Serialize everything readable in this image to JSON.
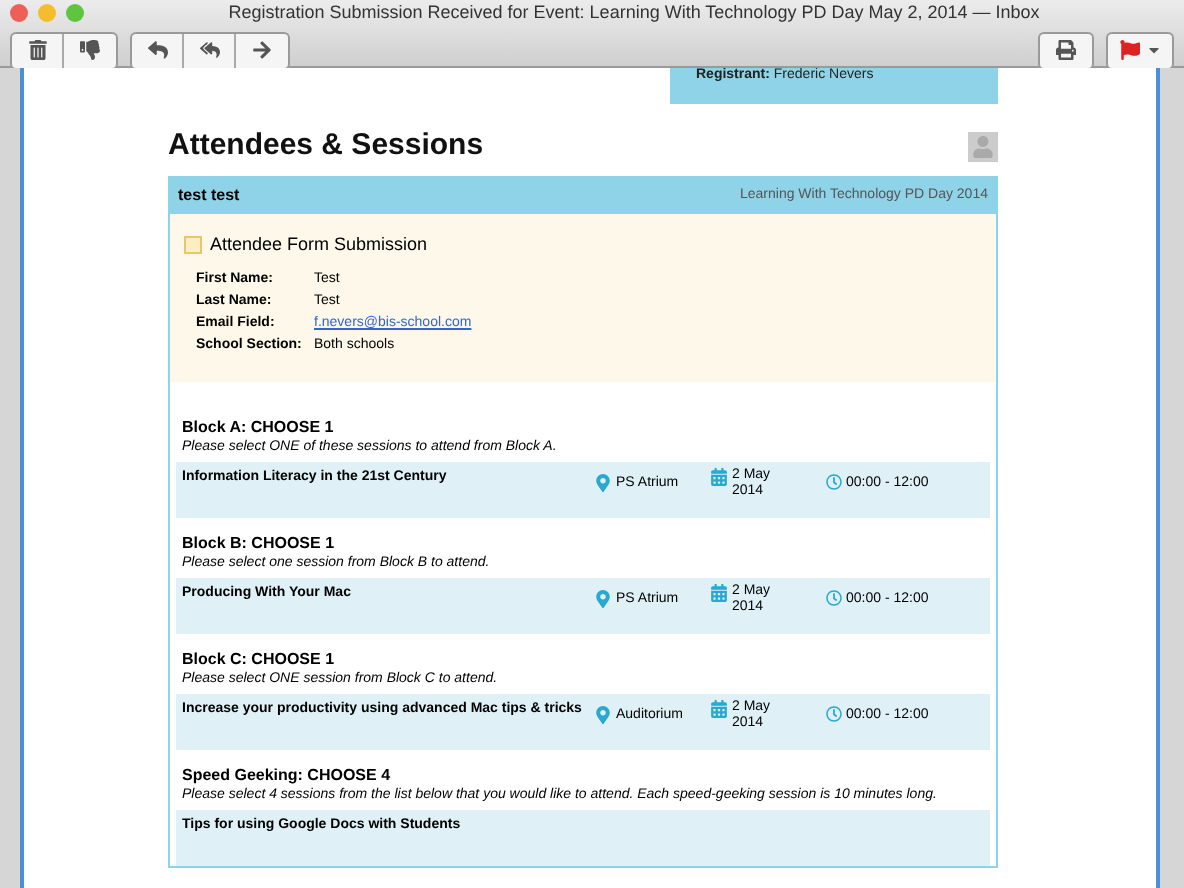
{
  "window": {
    "title": "Registration Submission Received for Event: Learning With Technology PD Day May 2, 2014 — Inbox"
  },
  "registrant": {
    "label": "Registrant:",
    "value": "Frederic Nevers"
  },
  "heading": "Attendees & Sessions",
  "attendee": {
    "name": "test test",
    "event": "Learning With Technology PD Day 2014",
    "form_title": "Attendee Form Submission",
    "fields": [
      {
        "label": "First Name:",
        "value": "Test",
        "kind": "text"
      },
      {
        "label": "Last Name:",
        "value": "Test",
        "kind": "text"
      },
      {
        "label": "Email Field:",
        "value": "f.nevers@bis-school.com",
        "kind": "link"
      },
      {
        "label": "School Section:",
        "value": "Both schools",
        "kind": "text"
      }
    ]
  },
  "blocks": [
    {
      "title": "Block A: CHOOSE 1",
      "note": "Please select ONE of these sessions to attend from Block A.",
      "sessions": [
        {
          "title": "Information Literacy in the 21st Century",
          "location": "PS Atrium",
          "date": "2 May 2014",
          "time": "00:00 - 12:00"
        }
      ]
    },
    {
      "title": "Block B: CHOOSE 1",
      "note": "Please select one session from Block B to attend.",
      "sessions": [
        {
          "title": "Producing With Your Mac",
          "location": "PS Atrium",
          "date": "2 May 2014",
          "time": "00:00 - 12:00"
        }
      ]
    },
    {
      "title": "Block C: CHOOSE 1",
      "note": "Please select ONE session from Block C to attend.",
      "sessions": [
        {
          "title": "Increase your productivity using advanced Mac tips & tricks",
          "location": "Auditorium",
          "date": "2 May 2014",
          "time": "00:00 - 12:00"
        }
      ]
    },
    {
      "title": "Speed Geeking: CHOOSE 4",
      "note": "Please select 4 sessions from the list below that you would like to attend. Each speed-geeking session is 10 minutes long.",
      "sessions": [
        {
          "title": "Tips for using Google Docs with Students"
        }
      ]
    }
  ]
}
